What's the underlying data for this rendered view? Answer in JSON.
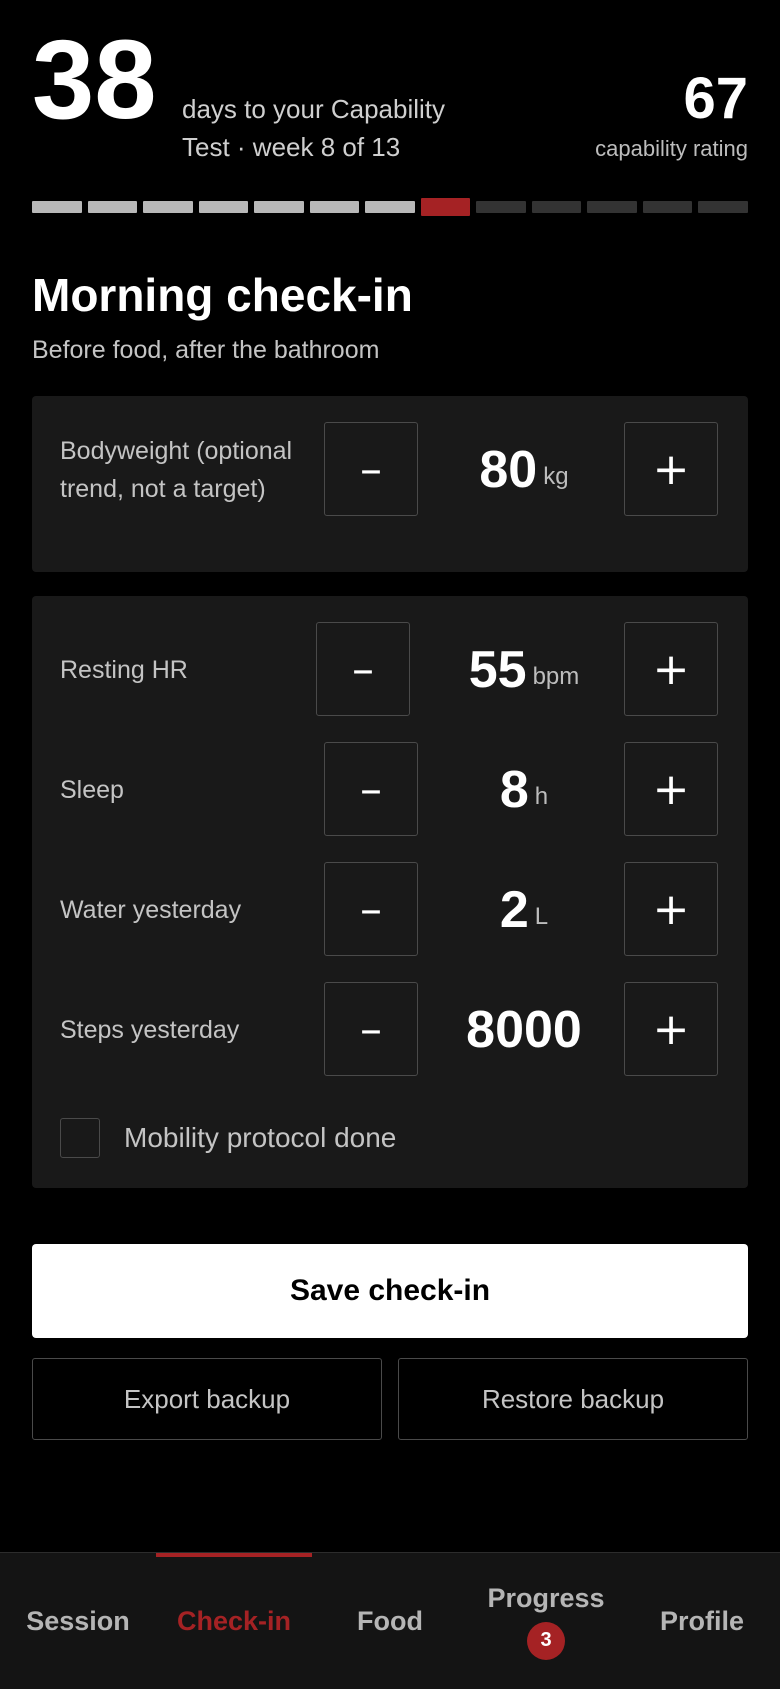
{
  "header": {
    "days_number": "38",
    "days_text_line1": "days to your Capability",
    "days_text_line2": "Test · week 8 of 13",
    "rating_value": "67",
    "rating_label": "capability rating"
  },
  "week_progress": {
    "total_weeks": 13,
    "current_week": 8,
    "colors": {
      "done": "#b8b8b8",
      "current": "#a52224",
      "upcoming": "#333333"
    }
  },
  "checkin": {
    "title": "Morning check-in",
    "subtitle": "Before food, after the bathroom",
    "bodyweight": {
      "label": "Bodyweight (optional trend, not a target)",
      "value": "80",
      "unit": "kg",
      "minus": "–",
      "plus": "+"
    },
    "metrics": [
      {
        "label": "Resting HR",
        "value": "55",
        "unit": "bpm",
        "minus": "–",
        "plus": "+"
      },
      {
        "label": "Sleep",
        "value": "8",
        "unit": "h",
        "minus": "–",
        "plus": "+"
      },
      {
        "label": "Water yesterday",
        "value": "2",
        "unit": "L",
        "minus": "–",
        "plus": "+"
      },
      {
        "label": "Steps yesterday",
        "value": "8000",
        "unit": "",
        "minus": "–",
        "plus": "+"
      }
    ],
    "mobility_label": "Mobility protocol done",
    "mobility_checked": false
  },
  "actions": {
    "save": "Save check-in",
    "export": "Export backup",
    "restore": "Restore backup"
  },
  "tabs": [
    {
      "label": "Session",
      "active": false
    },
    {
      "label": "Check-in",
      "active": true
    },
    {
      "label": "Food",
      "active": false
    },
    {
      "label": "Progress",
      "active": false,
      "badge": "3"
    },
    {
      "label": "Profile",
      "active": false
    }
  ],
  "colors": {
    "accent": "#a52224",
    "background": "#000000",
    "card": "#191919"
  }
}
